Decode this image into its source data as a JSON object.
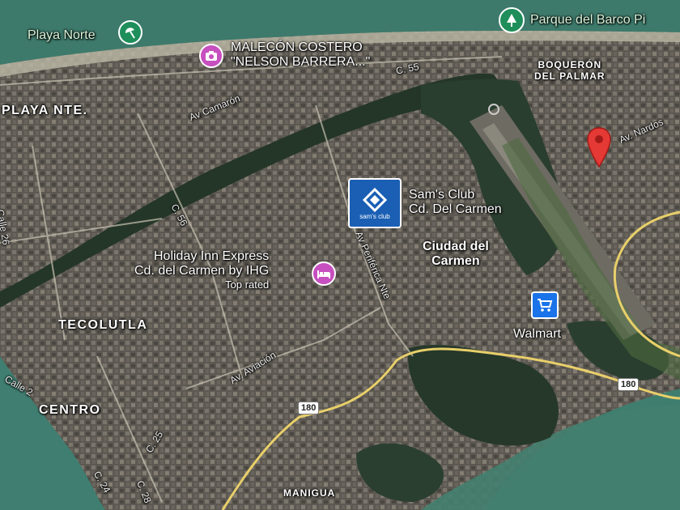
{
  "map": {
    "areas": {
      "playa_nte": "PLAYA NTE.",
      "tecolutla": "TECOLUTLA",
      "centro": "CENTRO",
      "manigua": "MANIGUA",
      "boqueron_line1": "BOQUERÓN",
      "boqueron_line2": "DEL PALMAR",
      "ciudad_line1": "Ciudad del",
      "ciudad_line2": "Carmen"
    },
    "streets": {
      "av_camaron": "Av Camarón",
      "c55": "C. 55",
      "c56": "C. 56",
      "calle26": "Calle 26",
      "calle2": "Calle 2",
      "c25": "C. 25",
      "c24": "C. 24",
      "c28": "C. 28",
      "av_periferica": "Av Periférica Nte",
      "av_aviacion": "Av. Aviación",
      "av_nardos": "Av. Nardos",
      "route180a": "180",
      "route180b": "180"
    },
    "pois": {
      "playa_norte": "Playa Norte",
      "parque": "Parque del Barco Pi",
      "malecon_line1": "MALECÓN COSTERO",
      "malecon_line2": "\"NELSON BARRERA...\"",
      "sams_line1": "Sam's Club",
      "sams_line2": "Cd. Del Carmen",
      "sams_logo": "sam's club",
      "holiday_line1": "Holiday Inn Express",
      "holiday_line2": "Cd. del Carmen by IHG",
      "holiday_badge": "Top rated",
      "walmart": "Walmart"
    },
    "icons": {
      "beach": "beach-umbrella-icon",
      "park": "tree-icon",
      "camera": "camera-icon",
      "hotel": "bed-icon",
      "cart": "shopping-cart-icon",
      "pin": "location-pin-icon"
    },
    "colors": {
      "water": "#3f7d6e",
      "urban": "#5a5650",
      "mangrove": "#263a2c",
      "poi_green": "#1e8e5a",
      "poi_pink": "#c74fbf",
      "poi_blue": "#1a73e8",
      "pin_red": "#e53935",
      "road_yellow": "#e8cf6a"
    }
  }
}
